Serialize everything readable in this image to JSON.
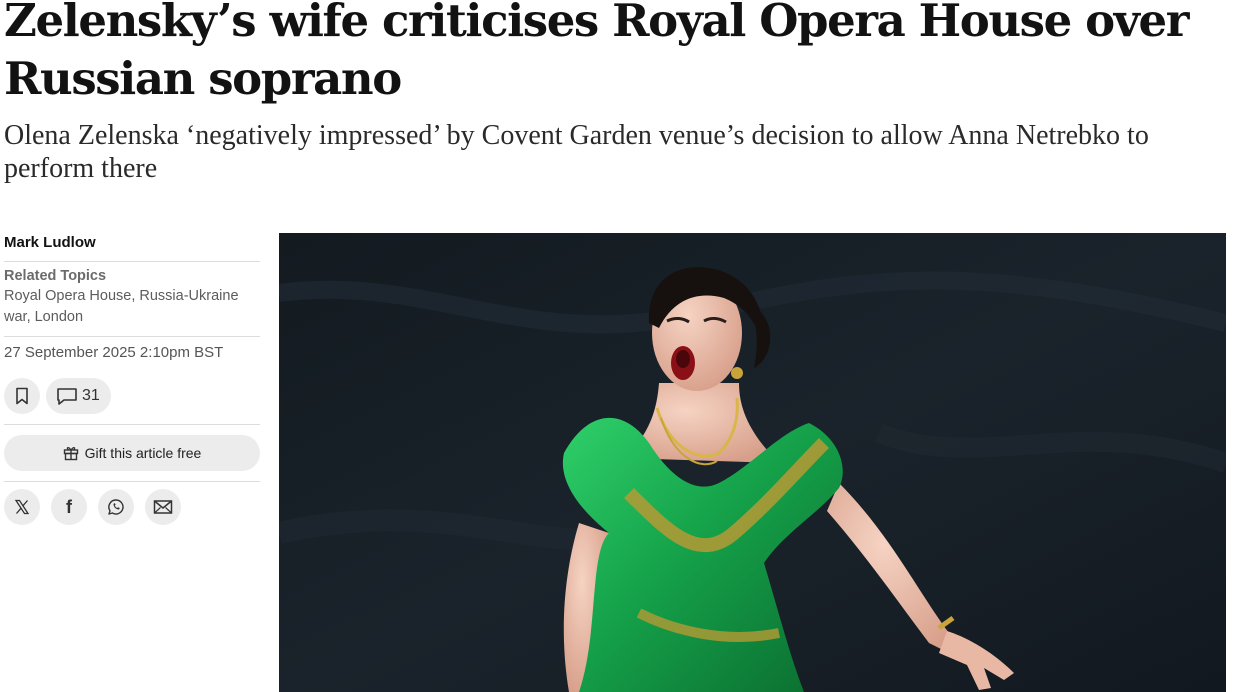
{
  "article": {
    "headline": "Zelensky’s wife criticises Royal Opera House over Russian soprano",
    "standfirst": "Olena Zelenska ‘negatively impressed’ by Covent Garden venue’s decision to allow Anna Netrebko to perform there"
  },
  "sidebar": {
    "author": "Mark Ludlow",
    "topics_label": "Related Topics",
    "topics_value": "Royal Opera House, Russia-Ukraine war, London",
    "date": "27 September 2025 2:10pm BST",
    "comment_count": "31",
    "gift_label": "Gift this article free",
    "icons": {
      "bookmark": "bookmark-icon",
      "comment": "comment-icon",
      "gift": "gift-icon",
      "share": [
        "x-icon",
        "facebook-icon",
        "whatsapp-icon",
        "email-icon"
      ]
    }
  },
  "photo": {
    "subject": "soprano-in-green-gown-icon"
  },
  "colors": {
    "text": "#121212",
    "muted": "#6b6b6b",
    "button_bg": "#ececec",
    "photo_bg": "#151c22",
    "gown": "#17a34a"
  }
}
